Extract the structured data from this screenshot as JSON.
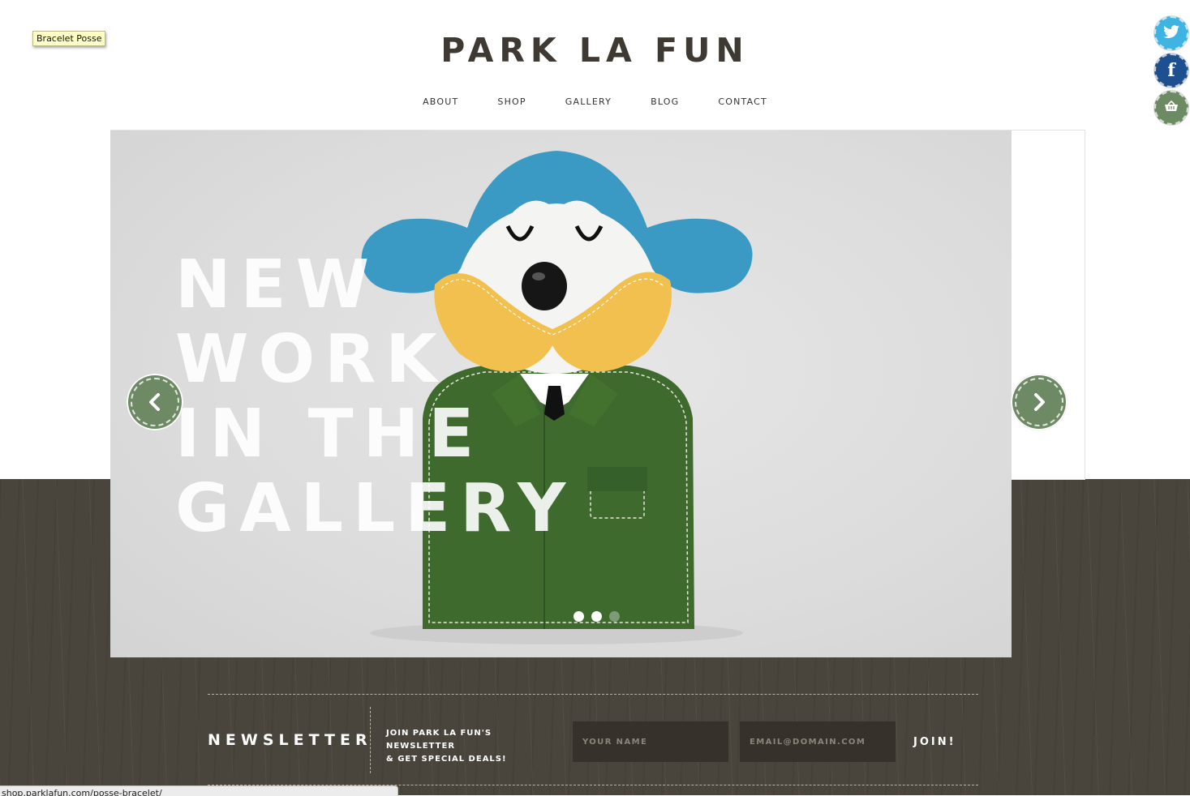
{
  "tooltip": "Bracelet Posse",
  "header": {
    "logo": "PARK LA FUN",
    "nav": [
      "ABOUT",
      "SHOP",
      "GALLERY",
      "BLOG",
      "CONTACT"
    ]
  },
  "social": {
    "icons": [
      "twitter-icon",
      "facebook-icon",
      "basket-icon"
    ],
    "facebook_glyph": "f"
  },
  "slider": {
    "headline": [
      "NEW",
      "WORK",
      "IN THE",
      "GALLERY"
    ],
    "active_slide": 1,
    "slide_count": 3,
    "prev_glyph": "‹",
    "next_glyph": "›"
  },
  "newsletter": {
    "title": "NEWSLETTER",
    "description_line1": "JOIN PARK LA FUN'S NEWSLETTER",
    "description_line2": "& GET SPECIAL DEALS!",
    "name_placeholder": "YOUR NAME",
    "email_placeholder": "EMAIL@DOMAIN.COM",
    "join_label": "JOIN!"
  },
  "status_url": "shop.parklafun.com/posse-bracelet/",
  "colors": {
    "logo": "#3e3a33",
    "accent_green": "#6e8a64",
    "wood": "#4a453c",
    "twitter": "#3fb3e2",
    "facebook": "#1e4f8f"
  }
}
